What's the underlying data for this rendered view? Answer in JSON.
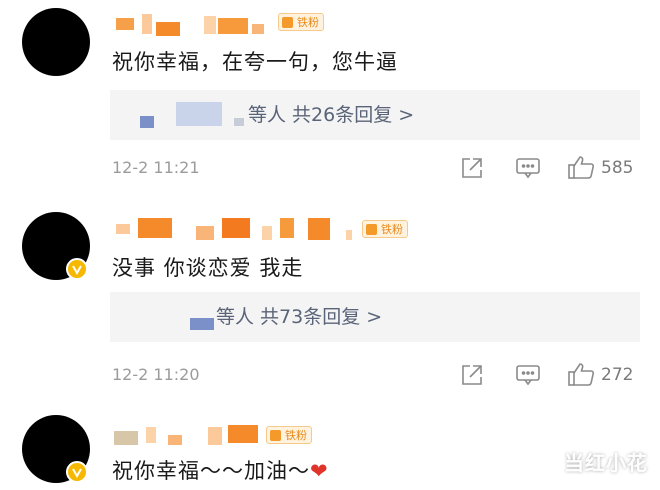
{
  "comments": [
    {
      "name_badge": "铁粉",
      "text": "祝你幸福，在夸一句，您牛逼",
      "reply_summary": "等人 共26条回复 >",
      "timestamp": "12-2 11:21",
      "like_count": "585",
      "verified": false
    },
    {
      "name_badge": "铁粉",
      "text": "没事 你谈恋爱 我走",
      "reply_summary": "等人 共73条回复 >",
      "timestamp": "12-2 11:20",
      "like_count": "272",
      "verified": true
    },
    {
      "name_badge": "铁粉",
      "text": "祝你幸福～～加油～",
      "emoji": "❤",
      "verified": true
    }
  ],
  "watermark": "当红小花",
  "colors": {
    "accent_orange": "#f39a2b",
    "reply_link": "#5a6478",
    "meta_gray": "#9b9b9b",
    "heart": "#e0342b"
  },
  "icons": [
    "share-icon",
    "comment-icon",
    "like-icon",
    "verified-icon"
  ]
}
